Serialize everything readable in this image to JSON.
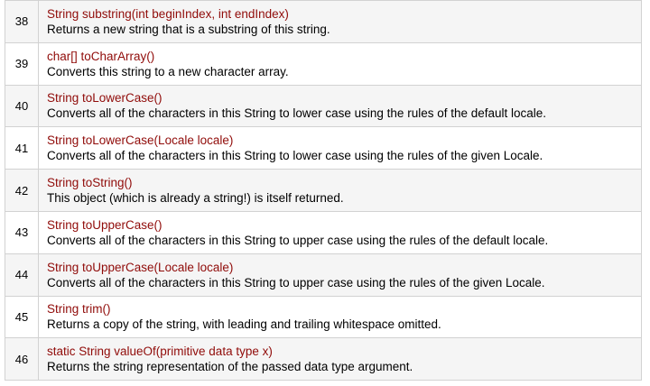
{
  "methods": [
    {
      "num": "38",
      "signature": "String substring(int beginIndex, int endIndex)",
      "description": "Returns a new string that is a substring of this string."
    },
    {
      "num": "39",
      "signature": "char[] toCharArray()",
      "description": "Converts this string to a new character array."
    },
    {
      "num": "40",
      "signature": "String toLowerCase()",
      "description": "Converts all of the characters in this String to lower case using the rules of the default locale."
    },
    {
      "num": "41",
      "signature": "String toLowerCase(Locale locale)",
      "description": "Converts all of the characters in this String to lower case using the rules of the given Locale."
    },
    {
      "num": "42",
      "signature": "String toString()",
      "description": "This object (which is already a string!) is itself returned."
    },
    {
      "num": "43",
      "signature": "String toUpperCase()",
      "description": "Converts all of the characters in this String to upper case using the rules of the default locale."
    },
    {
      "num": "44",
      "signature": "String toUpperCase(Locale locale)",
      "description": "Converts all of the characters in this String to upper case using the rules of the given Locale."
    },
    {
      "num": "45",
      "signature": "String trim()",
      "description": "Returns a copy of the string, with leading and trailing whitespace omitted."
    },
    {
      "num": "46",
      "signature": "static String valueOf(primitive data type x)",
      "description": "Returns the string representation of the passed data type argument."
    }
  ],
  "colors": {
    "signature": "#900b09",
    "row_alt": "#f5f5f5",
    "border": "#d2d2d2"
  }
}
